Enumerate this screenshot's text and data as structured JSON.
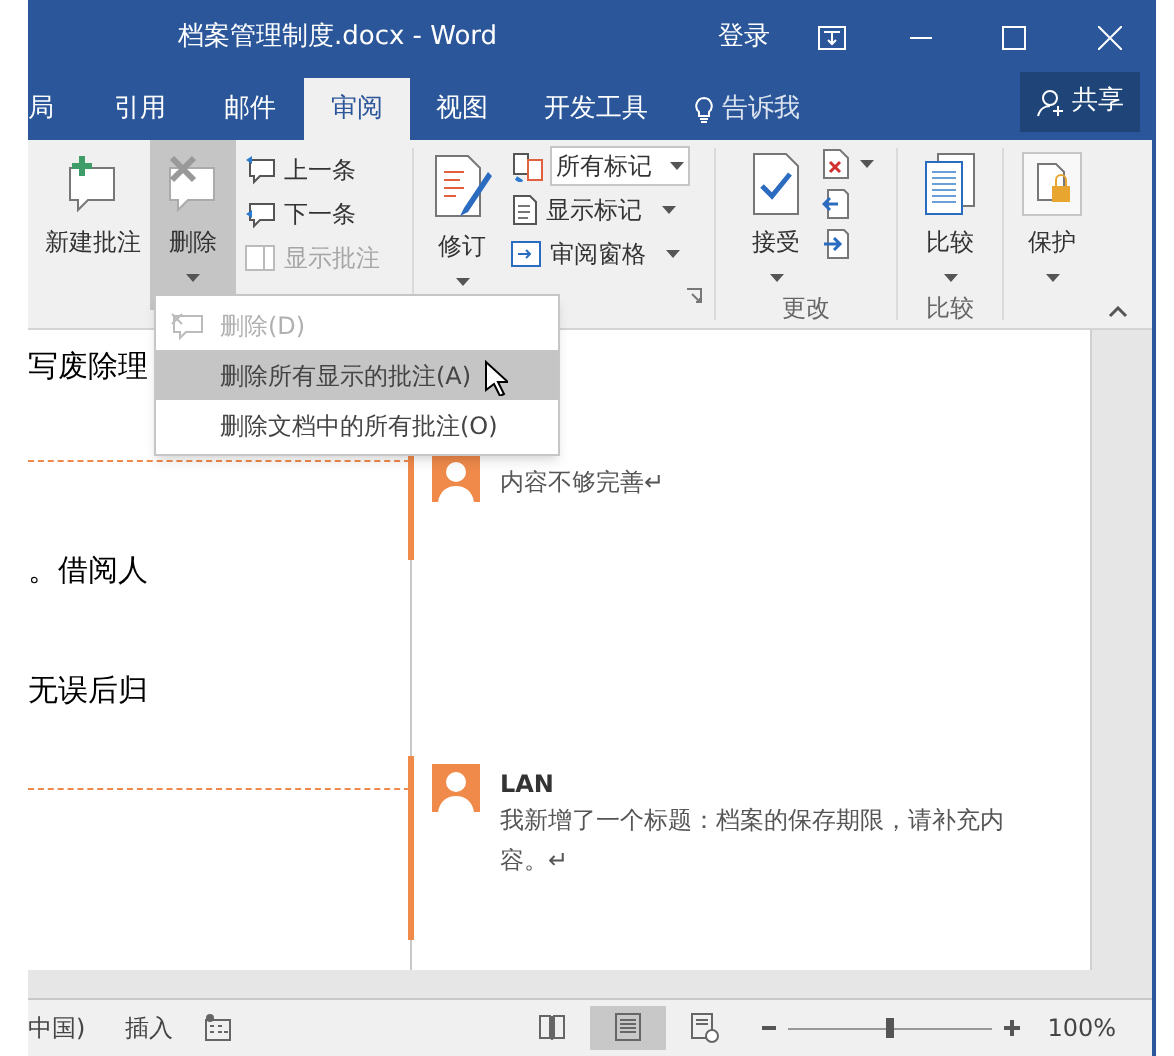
{
  "window": {
    "title": "档案管理制度.docx - Word",
    "sign_in": "登录"
  },
  "tabs": [
    {
      "label": "局",
      "selected": false
    },
    {
      "label": "引用",
      "selected": false
    },
    {
      "label": "邮件",
      "selected": false
    },
    {
      "label": "审阅",
      "selected": true
    },
    {
      "label": "视图",
      "selected": false
    },
    {
      "label": "开发工具",
      "selected": false
    }
  ],
  "tell_me": "告诉我",
  "share": "共享",
  "ribbon": {
    "new_comment": "新建批注",
    "delete": {
      "label": "删除",
      "pressed": true
    },
    "previous": "上一条",
    "next": "下一条",
    "show_comments": {
      "label": "显示批注",
      "disabled": true
    },
    "track_changes": "修订",
    "markup_select": {
      "value": "所有标记"
    },
    "show_markup": "显示标记",
    "reviewing_pane": "审阅窗格",
    "accept": "接受",
    "changes_label": "更改",
    "compare": "比较",
    "compare_label": "比较",
    "protect": "保护"
  },
  "menu": [
    {
      "label": "删除(D)",
      "disabled": true,
      "selected": false
    },
    {
      "label": "删除所有显示的批注(A)",
      "disabled": false,
      "selected": true
    },
    {
      "label": "删除文档中的所有批注(O)",
      "disabled": false,
      "selected": false
    }
  ],
  "document": {
    "lines": [
      "写废除理",
      "。借阅人",
      "无误后归"
    ]
  },
  "comments": [
    {
      "text": "内容不够完善↵"
    },
    {
      "author": "LAN",
      "text": "我新增了一个标题：档案的保存期限，请补充内容。↵"
    }
  ],
  "status_bar": {
    "language": "中国)",
    "mode": "插入",
    "views": [
      {
        "kind": "read",
        "selected": false
      },
      {
        "kind": "print",
        "selected": true
      },
      {
        "kind": "web",
        "selected": false
      }
    ],
    "zoom": {
      "level": 0.5,
      "reading": "100%"
    }
  }
}
